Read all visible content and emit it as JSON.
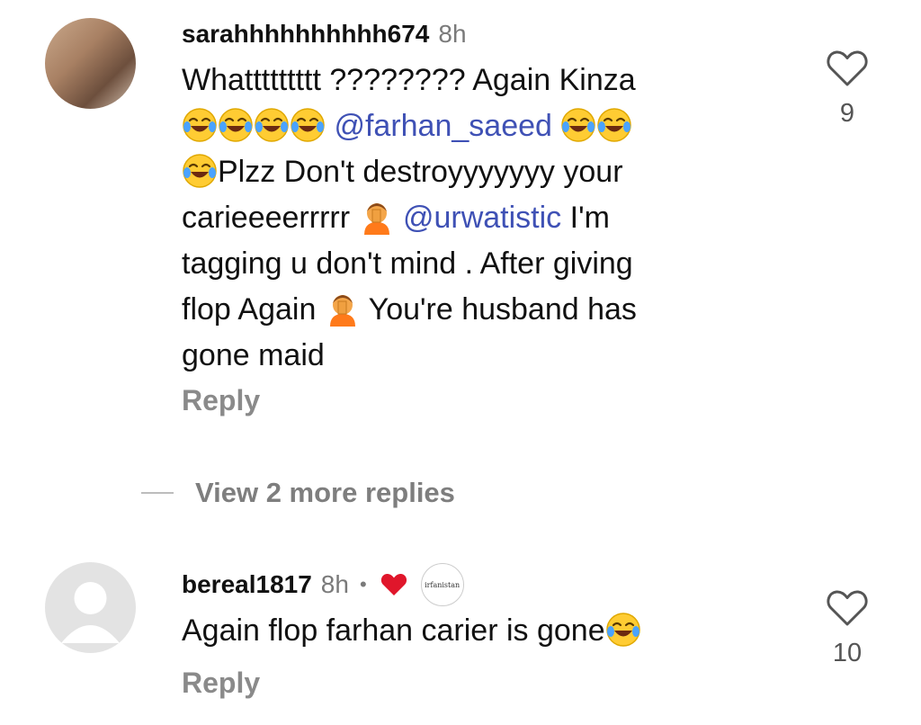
{
  "comments": [
    {
      "username": "sarahhhhhhhhhh674",
      "time": "8h",
      "text_parts": {
        "l1": "Whattttttttt ???????? Again Kinza",
        "mention1": "@farhan_saeed",
        "l3": "Plzz Don't destroyyyyyyy your",
        "l4a": "carieeeerrrrr",
        "mention2": "@urwatistic",
        "l4b": "I'm",
        "l5": "tagging u don't mind . After giving",
        "l6a": "flop Again",
        "l6b": "You're husband has",
        "l7": "gone maid"
      },
      "reply_label": "Reply",
      "like_count": "9"
    },
    {
      "username": "bereal1817",
      "time": "8h",
      "separator": "•",
      "badge_text": "irfanistan",
      "text": "Again flop farhan carier is gone",
      "reply_label": "Reply",
      "like_count": "10"
    }
  ],
  "view_more": "View 2 more replies",
  "colors": {
    "mention": "#3f51b5",
    "heart_red": "#e0162b",
    "muted": "#7a7a7a"
  },
  "icons": [
    "heart-outline-icon",
    "red-heart-icon",
    "laughing-emoji-icon",
    "facepalm-emoji-icon"
  ]
}
